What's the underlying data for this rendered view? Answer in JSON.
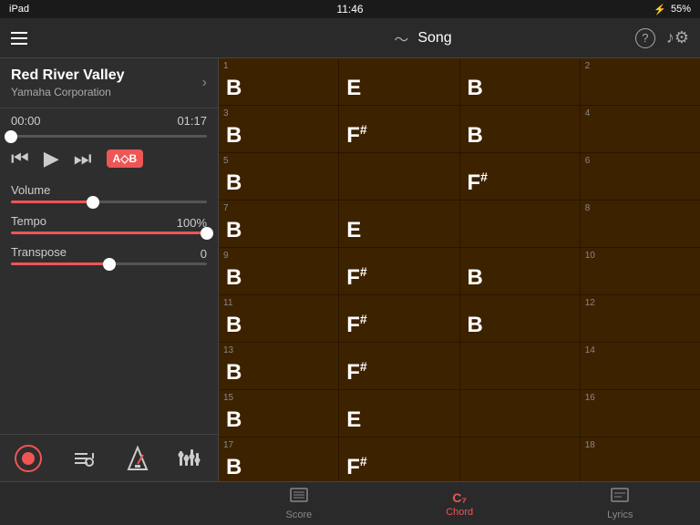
{
  "statusBar": {
    "left": "iPad",
    "time": "11:46",
    "battery": "55%",
    "bluetooth": "BT"
  },
  "topBar": {
    "songLabel": "Song",
    "helpLabel": "?",
    "settingsLabel": "⚙"
  },
  "sidebar": {
    "songName": "Red River Valley",
    "composer": "Yamaha Corporation",
    "timeStart": "00:00",
    "timeEnd": "01:17",
    "progressPercent": 0,
    "volumePercent": 42,
    "tempoPercent": 100,
    "tempoLabel": "100%",
    "transposeValue": 0,
    "transposePercent": 50
  },
  "transport": {
    "rewindLabel": "⏮",
    "playLabel": "▶",
    "forwardLabel": "⏭",
    "abLabel": "A⬦B"
  },
  "controls": {
    "volumeLabel": "Volume",
    "tempoLabel": "Tempo",
    "transposeLabel": "Transpose",
    "transposeValue": "0"
  },
  "chordGrid": {
    "rows": [
      [
        {
          "num": 1,
          "chord": "B",
          "sharp": false
        },
        {
          "num": "",
          "chord": "E",
          "sharp": false
        },
        {
          "num": "",
          "chord": "B",
          "sharp": false
        },
        {
          "num": 2,
          "chord": "",
          "sharp": false
        }
      ],
      [
        {
          "num": 3,
          "chord": "B",
          "sharp": false
        },
        {
          "num": "",
          "chord": "F",
          "sharp": true
        },
        {
          "num": "",
          "chord": "B",
          "sharp": false
        },
        {
          "num": 4,
          "chord": "",
          "sharp": false
        }
      ],
      [
        {
          "num": 5,
          "chord": "B",
          "sharp": false
        },
        {
          "num": "",
          "chord": "",
          "sharp": false
        },
        {
          "num": "",
          "chord": "F",
          "sharp": true
        },
        {
          "num": 6,
          "chord": "",
          "sharp": false
        }
      ],
      [
        {
          "num": 7,
          "chord": "B",
          "sharp": false
        },
        {
          "num": "",
          "chord": "E",
          "sharp": false
        },
        {
          "num": "",
          "chord": "",
          "sharp": false
        },
        {
          "num": 8,
          "chord": "",
          "sharp": false
        }
      ],
      [
        {
          "num": 9,
          "chord": "B",
          "sharp": false
        },
        {
          "num": "",
          "chord": "F",
          "sharp": true
        },
        {
          "num": "",
          "chord": "B",
          "sharp": false
        },
        {
          "num": 10,
          "chord": "",
          "sharp": false
        }
      ],
      [
        {
          "num": 11,
          "chord": "B",
          "sharp": false
        },
        {
          "num": "",
          "chord": "F",
          "sharp": true
        },
        {
          "num": "",
          "chord": "B",
          "sharp": false
        },
        {
          "num": 12,
          "chord": "",
          "sharp": false
        }
      ],
      [
        {
          "num": 13,
          "chord": "B",
          "sharp": false
        },
        {
          "num": "",
          "chord": "F",
          "sharp": true
        },
        {
          "num": "",
          "chord": "",
          "sharp": false
        },
        {
          "num": 14,
          "chord": "",
          "sharp": false
        }
      ],
      [
        {
          "num": 15,
          "chord": "B",
          "sharp": false
        },
        {
          "num": "",
          "chord": "E",
          "sharp": false
        },
        {
          "num": "",
          "chord": "",
          "sharp": false
        },
        {
          "num": 16,
          "chord": "",
          "sharp": false
        }
      ],
      [
        {
          "num": 17,
          "chord": "B",
          "sharp": false
        },
        {
          "num": "",
          "chord": "F",
          "sharp": true
        },
        {
          "num": "",
          "chord": "",
          "sharp": false
        },
        {
          "num": 18,
          "chord": "",
          "sharp": false
        }
      ]
    ]
  },
  "bottomTabs": {
    "scoreLabel": "Score",
    "chordLabel": "Chord",
    "lyricsLabel": "Lyrics",
    "activeTab": "chord"
  },
  "sidebarBottomIcons": {
    "record": "●",
    "tracks": "🎵",
    "metronome": "🎼",
    "mixer": "⚖"
  }
}
